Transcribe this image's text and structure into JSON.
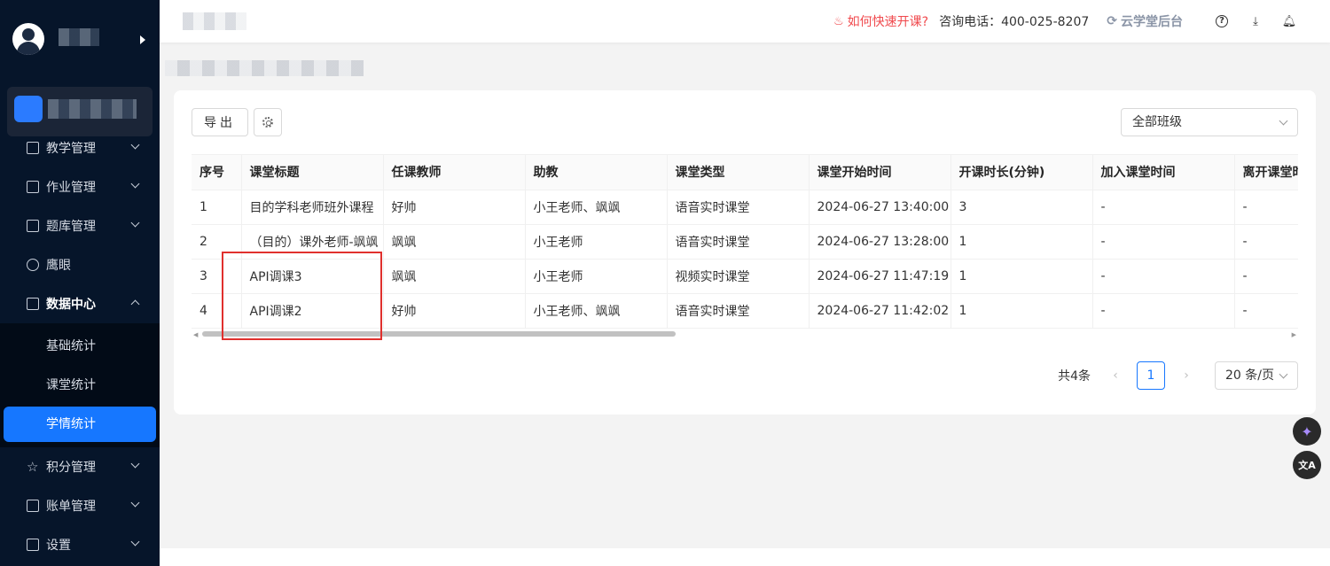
{
  "header": {
    "quick_start_link": "如何快速开课?",
    "phone_text": "咨询电话：400-025-8207",
    "backend_link": "云学堂后台"
  },
  "sidebar": {
    "menu": [
      {
        "label": "教学管理",
        "icon": "book-icon"
      },
      {
        "label": "作业管理",
        "icon": "homework-icon"
      },
      {
        "label": "题库管理",
        "icon": "question-bank-icon"
      },
      {
        "label": "鹰眼",
        "icon": "eye-icon"
      },
      {
        "label": "数据中心",
        "icon": "chart-icon"
      },
      {
        "label": "积分管理",
        "icon": "star-icon"
      },
      {
        "label": "账单管理",
        "icon": "bill-icon"
      },
      {
        "label": "设置",
        "icon": "grid-icon"
      }
    ],
    "submenu": [
      {
        "label": "基础统计"
      },
      {
        "label": "课堂统计"
      },
      {
        "label": "学情统计"
      }
    ]
  },
  "toolbar": {
    "export_label": "导出",
    "class_select_value": "全部班级"
  },
  "table": {
    "headers": [
      "序号",
      "课堂标题",
      "任课教师",
      "助教",
      "课堂类型",
      "课堂开始时间",
      "开课时长(分钟)",
      "加入课堂时间",
      "离开课堂时间"
    ],
    "rows": [
      [
        "1",
        "目的学科老师班外课程",
        "好帅",
        "小王老师、飒飒",
        "语音实时课堂",
        "2024-06-27 13:40:00",
        "3",
        "-",
        "-"
      ],
      [
        "2",
        "（目的）课外老师-飒飒",
        "飒飒",
        "小王老师",
        "语音实时课堂",
        "2024-06-27 13:28:00",
        "1",
        "-",
        "-"
      ],
      [
        "3",
        "API调课3",
        "飒飒",
        "小王老师",
        "视频实时课堂",
        "2024-06-27 11:47:19",
        "1",
        "-",
        "-"
      ],
      [
        "4",
        "API调课2",
        "好帅",
        "小王老师、飒飒",
        "语音实时课堂",
        "2024-06-27 11:42:02",
        "1",
        "-",
        "-"
      ]
    ]
  },
  "pagination": {
    "total": "共4条",
    "current_page": "1",
    "page_size": "20 条/页"
  },
  "colors": {
    "sidebar_bg": "#06152a",
    "accent": "#1677ff",
    "highlight": "#e0302d"
  }
}
